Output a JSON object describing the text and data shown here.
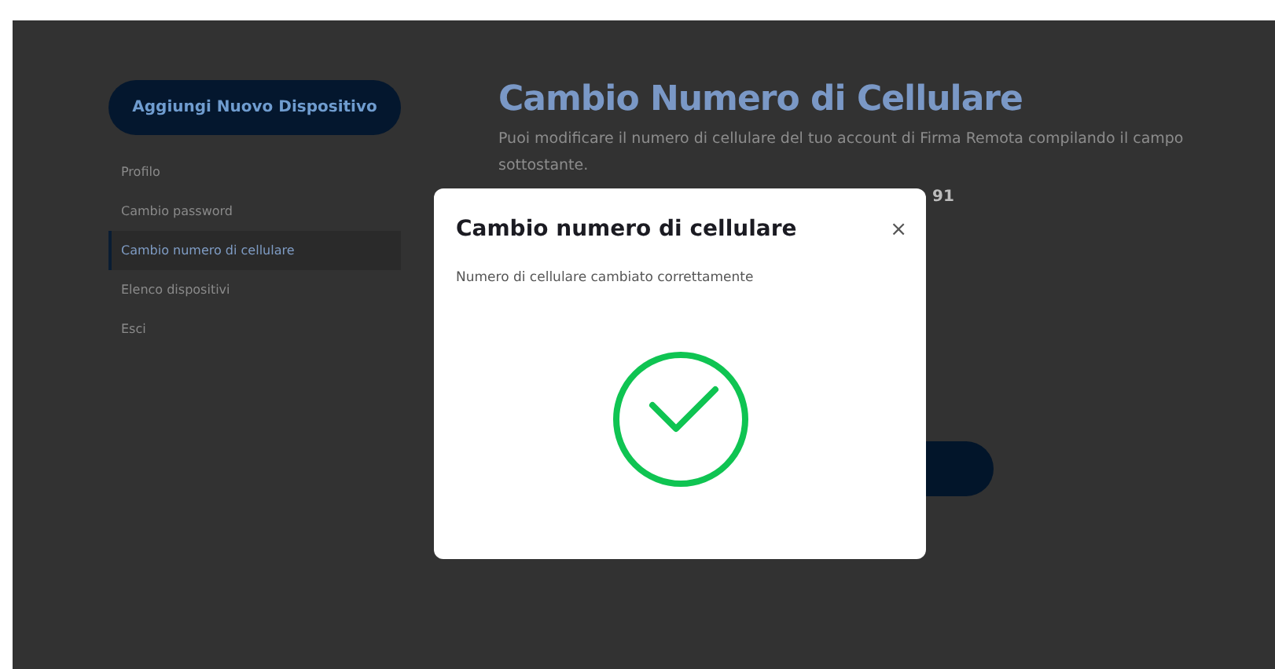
{
  "sidebar": {
    "add_button": "Aggiungi Nuovo Dispositivo",
    "items": [
      {
        "label": "Profilo",
        "selected": false
      },
      {
        "label": "Cambio password",
        "selected": false
      },
      {
        "label": "Cambio numero di cellulare",
        "selected": true
      },
      {
        "label": "Elenco dispositivi",
        "selected": false
      },
      {
        "label": "Esci",
        "selected": false
      }
    ]
  },
  "main": {
    "title": "Cambio Numero di Cellulare",
    "description": "Puoi modificare il numero di cellulare del tuo account di Firma Remota compilando il campo sottostante.",
    "phone_fragment": "91"
  },
  "modal": {
    "title": "Cambio numero di cellulare",
    "close": "×",
    "message": "Numero di cellulare cambiato correttamente"
  }
}
